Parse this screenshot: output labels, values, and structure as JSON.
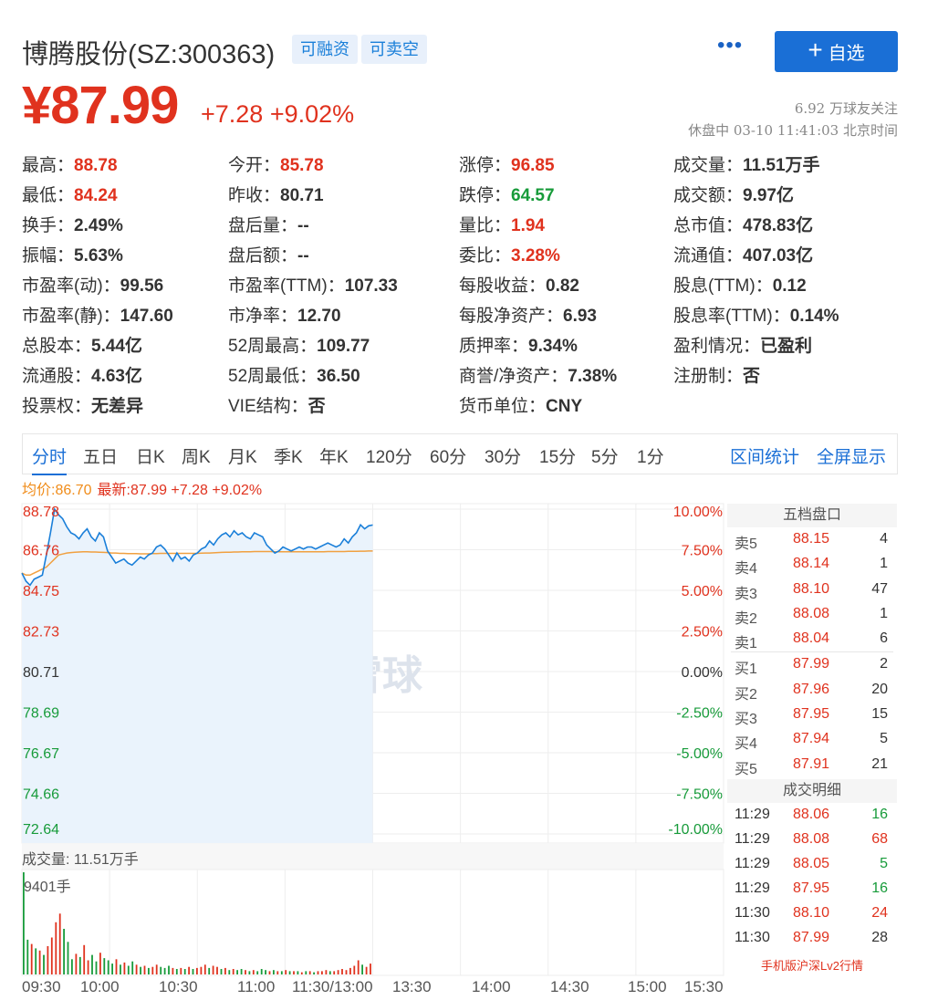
{
  "header": {
    "name": "博腾股份(SZ:300363)",
    "tags": [
      "可融资",
      "可卖空"
    ],
    "more": "•••",
    "follow_label": "自选",
    "price": "¥87.99",
    "change": "+7.28",
    "change_pct": "+9.02%",
    "followers": "6.92 万球友关注",
    "status": "休盘中 03-10 11:41:03 北京时间"
  },
  "quote": [
    [
      {
        "k": "最高：",
        "v": "88.78",
        "c": "red"
      },
      {
        "k": "今开：",
        "v": "85.78",
        "c": "red"
      },
      {
        "k": "涨停：",
        "v": "96.85",
        "c": "red"
      },
      {
        "k": "成交量：",
        "v": "11.51万手",
        "c": "dark"
      }
    ],
    [
      {
        "k": "最低：",
        "v": "84.24",
        "c": "red"
      },
      {
        "k": "昨收：",
        "v": "80.71",
        "c": "dark"
      },
      {
        "k": "跌停：",
        "v": "64.57",
        "c": "green"
      },
      {
        "k": "成交额：",
        "v": "9.97亿",
        "c": "dark"
      }
    ],
    [
      {
        "k": "换手：",
        "v": "2.49%",
        "c": "dark"
      },
      {
        "k": "盘后量：",
        "v": "--",
        "c": "dark"
      },
      {
        "k": "量比：",
        "v": "1.94",
        "c": "red"
      },
      {
        "k": "总市值：",
        "v": "478.83亿",
        "c": "dark"
      }
    ],
    [
      {
        "k": "振幅：",
        "v": "5.63%",
        "c": "dark"
      },
      {
        "k": "盘后额：",
        "v": "--",
        "c": "dark"
      },
      {
        "k": "委比：",
        "v": "3.28%",
        "c": "red"
      },
      {
        "k": "流通值：",
        "v": "407.03亿",
        "c": "dark"
      }
    ],
    [
      {
        "k": "市盈率(动)：",
        "v": "99.56",
        "c": "dark"
      },
      {
        "k": "市盈率(TTM)：",
        "v": "107.33",
        "c": "dark"
      },
      {
        "k": "每股收益：",
        "v": "0.82",
        "c": "dark"
      },
      {
        "k": "股息(TTM)：",
        "v": "0.12",
        "c": "dark"
      }
    ],
    [
      {
        "k": "市盈率(静)：",
        "v": "147.60",
        "c": "dark"
      },
      {
        "k": "市净率：",
        "v": "12.70",
        "c": "dark"
      },
      {
        "k": "每股净资产：",
        "v": "6.93",
        "c": "dark"
      },
      {
        "k": "股息率(TTM)：",
        "v": "0.14%",
        "c": "dark"
      }
    ],
    [
      {
        "k": "总股本：",
        "v": "5.44亿",
        "c": "dark"
      },
      {
        "k": "52周最高：",
        "v": "109.77",
        "c": "dark"
      },
      {
        "k": "质押率：",
        "v": "9.34%",
        "c": "dark"
      },
      {
        "k": "盈利情况：",
        "v": "已盈利",
        "c": "dark"
      }
    ],
    [
      {
        "k": "流通股：",
        "v": "4.63亿",
        "c": "dark"
      },
      {
        "k": "52周最低：",
        "v": "36.50",
        "c": "dark"
      },
      {
        "k": "商誉/净资产：",
        "v": "7.38%",
        "c": "dark"
      },
      {
        "k": "注册制：",
        "v": "否",
        "c": "dark"
      }
    ],
    [
      {
        "k": "投票权：",
        "v": "无差异",
        "c": "dark"
      },
      {
        "k": "VIE结构：",
        "v": "否",
        "c": "dark"
      },
      {
        "k": "货币单位：",
        "v": "CNY",
        "c": "dark"
      }
    ]
  ],
  "tabs": [
    "分时",
    "五日",
    "日K",
    "周K",
    "月K",
    "季K",
    "年K",
    "120分",
    "60分",
    "30分",
    "15分",
    "5分",
    "1分"
  ],
  "tab_right": [
    "区间统计",
    "全屏显示"
  ],
  "chart_header": {
    "avg": "均价:86.70",
    "latest": "最新:87.99 +7.28 +9.02%"
  },
  "chart_data": {
    "type": "line",
    "y_left_ticks": [
      "88.78",
      "86.76",
      "84.75",
      "82.73",
      "80.71",
      "78.69",
      "76.67",
      "74.66",
      "72.64"
    ],
    "y_right_ticks": [
      "10.00%",
      "7.50%",
      "5.00%",
      "2.50%",
      "0.00%",
      "-2.50%",
      "-5.00%",
      "-7.50%",
      "-10.00%"
    ],
    "ylim": [
      72.64,
      88.78
    ],
    "x_ticks": [
      "09:30",
      "10:00",
      "10:30",
      "11:00",
      "11:30/13:00",
      "13:30",
      "14:00",
      "14:30",
      "15:00",
      "15:30"
    ],
    "series": [
      {
        "values": [
          85.6,
          85.2,
          85.0,
          85.3,
          85.4,
          85.5,
          86.5,
          87.6,
          88.78,
          88.5,
          88.3,
          87.9,
          87.6,
          87.5,
          87.3,
          87.6,
          87.8,
          87.4,
          87.2,
          87.6,
          87.4,
          86.7,
          86.4,
          86.1,
          86.2,
          86.3,
          86.1,
          86.0,
          86.2,
          86.4,
          86.3,
          86.5,
          86.6,
          86.9,
          87.0,
          86.8,
          86.5,
          86.2,
          86.6,
          86.3,
          86.4,
          86.2,
          86.5,
          86.6,
          86.8,
          86.9,
          87.2,
          87.0,
          87.3,
          87.5,
          87.6,
          87.4,
          87.7,
          87.5,
          87.6,
          87.4,
          87.3,
          87.6,
          87.5,
          87.4,
          87.0,
          86.8,
          86.6,
          86.7,
          86.9,
          86.8,
          86.7,
          86.8,
          86.9,
          86.8,
          86.9,
          86.9,
          86.8,
          86.9,
          87.0,
          87.1,
          87.0,
          86.9,
          87.0,
          87.3,
          87.1,
          87.4,
          87.6,
          88.0,
          87.8,
          87.95,
          87.99
        ]
      },
      {
        "values": [
          85.6,
          85.5,
          85.5,
          85.6,
          85.7,
          85.8,
          85.9,
          86.1,
          86.3,
          86.5,
          86.55,
          86.6,
          86.62,
          86.64,
          86.65,
          86.66,
          86.66,
          86.65,
          86.65,
          86.64,
          86.63,
          86.62,
          86.6,
          86.6,
          86.58,
          86.58,
          86.57,
          86.57,
          86.57,
          86.56,
          86.56,
          86.56,
          86.57,
          86.57,
          86.58,
          86.58,
          86.58,
          86.58,
          86.58,
          86.58,
          86.58,
          86.58,
          86.58,
          86.58,
          86.59,
          86.6,
          86.6,
          86.61,
          86.62,
          86.63,
          86.64,
          86.64,
          86.65,
          86.65,
          86.66,
          86.66,
          86.66,
          86.67,
          86.67,
          86.67,
          86.67,
          86.67,
          86.66,
          86.66,
          86.66,
          86.66,
          86.66,
          86.66,
          86.66,
          86.66,
          86.66,
          86.66,
          86.66,
          86.66,
          86.66,
          86.67,
          86.67,
          86.67,
          86.67,
          86.67,
          86.68,
          86.68,
          86.68,
          86.69,
          86.69,
          86.7,
          86.7
        ]
      }
    ],
    "volume_label": "成交量: 11.51万手",
    "volume_max_label": "9401手",
    "volume": [
      {
        "v": 9401,
        "c": "green"
      },
      {
        "v": 3200,
        "c": "green"
      },
      {
        "v": 2800,
        "c": "red"
      },
      {
        "v": 2400,
        "c": "green"
      },
      {
        "v": 2200,
        "c": "red"
      },
      {
        "v": 1800,
        "c": "green"
      },
      {
        "v": 2600,
        "c": "red"
      },
      {
        "v": 3400,
        "c": "red"
      },
      {
        "v": 4800,
        "c": "red"
      },
      {
        "v": 5600,
        "c": "red"
      },
      {
        "v": 4200,
        "c": "green"
      },
      {
        "v": 3000,
        "c": "green"
      },
      {
        "v": 1400,
        "c": "green"
      },
      {
        "v": 1900,
        "c": "red"
      },
      {
        "v": 1600,
        "c": "green"
      },
      {
        "v": 2700,
        "c": "red"
      },
      {
        "v": 1300,
        "c": "red"
      },
      {
        "v": 1800,
        "c": "green"
      },
      {
        "v": 1200,
        "c": "green"
      },
      {
        "v": 2000,
        "c": "red"
      },
      {
        "v": 1500,
        "c": "green"
      },
      {
        "v": 1300,
        "c": "green"
      },
      {
        "v": 1000,
        "c": "green"
      },
      {
        "v": 1400,
        "c": "red"
      },
      {
        "v": 900,
        "c": "green"
      },
      {
        "v": 1100,
        "c": "red"
      },
      {
        "v": 800,
        "c": "green"
      },
      {
        "v": 1200,
        "c": "green"
      },
      {
        "v": 900,
        "c": "red"
      },
      {
        "v": 700,
        "c": "green"
      },
      {
        "v": 800,
        "c": "red"
      },
      {
        "v": 600,
        "c": "green"
      },
      {
        "v": 700,
        "c": "red"
      },
      {
        "v": 900,
        "c": "red"
      },
      {
        "v": 700,
        "c": "green"
      },
      {
        "v": 600,
        "c": "green"
      },
      {
        "v": 800,
        "c": "green"
      },
      {
        "v": 600,
        "c": "red"
      },
      {
        "v": 500,
        "c": "green"
      },
      {
        "v": 600,
        "c": "red"
      },
      {
        "v": 500,
        "c": "green"
      },
      {
        "v": 700,
        "c": "red"
      },
      {
        "v": 500,
        "c": "green"
      },
      {
        "v": 600,
        "c": "red"
      },
      {
        "v": 700,
        "c": "red"
      },
      {
        "v": 900,
        "c": "red"
      },
      {
        "v": 600,
        "c": "green"
      },
      {
        "v": 800,
        "c": "red"
      },
      {
        "v": 700,
        "c": "red"
      },
      {
        "v": 500,
        "c": "green"
      },
      {
        "v": 600,
        "c": "red"
      },
      {
        "v": 400,
        "c": "green"
      },
      {
        "v": 500,
        "c": "red"
      },
      {
        "v": 400,
        "c": "green"
      },
      {
        "v": 500,
        "c": "green"
      },
      {
        "v": 400,
        "c": "red"
      },
      {
        "v": 300,
        "c": "green"
      },
      {
        "v": 400,
        "c": "red"
      },
      {
        "v": 300,
        "c": "green"
      },
      {
        "v": 500,
        "c": "green"
      },
      {
        "v": 400,
        "c": "green"
      },
      {
        "v": 300,
        "c": "red"
      },
      {
        "v": 400,
        "c": "green"
      },
      {
        "v": 300,
        "c": "red"
      },
      {
        "v": 300,
        "c": "green"
      },
      {
        "v": 400,
        "c": "red"
      },
      {
        "v": 300,
        "c": "green"
      },
      {
        "v": 300,
        "c": "red"
      },
      {
        "v": 300,
        "c": "green"
      },
      {
        "v": 200,
        "c": "red"
      },
      {
        "v": 300,
        "c": "green"
      },
      {
        "v": 300,
        "c": "red"
      },
      {
        "v": 200,
        "c": "green"
      },
      {
        "v": 300,
        "c": "red"
      },
      {
        "v": 300,
        "c": "red"
      },
      {
        "v": 400,
        "c": "red"
      },
      {
        "v": 300,
        "c": "green"
      },
      {
        "v": 300,
        "c": "red"
      },
      {
        "v": 400,
        "c": "red"
      },
      {
        "v": 500,
        "c": "red"
      },
      {
        "v": 400,
        "c": "red"
      },
      {
        "v": 600,
        "c": "red"
      },
      {
        "v": 800,
        "c": "red"
      },
      {
        "v": 1300,
        "c": "red"
      },
      {
        "v": 900,
        "c": "green"
      },
      {
        "v": 700,
        "c": "red"
      },
      {
        "v": 1000,
        "c": "red"
      }
    ],
    "watermark": "雪球"
  },
  "book": {
    "title": "五档盘口",
    "asks": [
      {
        "lbl": "卖5",
        "p": "88.15",
        "v": "4"
      },
      {
        "lbl": "卖4",
        "p": "88.14",
        "v": "1"
      },
      {
        "lbl": "卖3",
        "p": "88.10",
        "v": "47"
      },
      {
        "lbl": "卖2",
        "p": "88.08",
        "v": "1"
      },
      {
        "lbl": "卖1",
        "p": "88.04",
        "v": "6"
      }
    ],
    "bids": [
      {
        "lbl": "买1",
        "p": "87.99",
        "v": "2"
      },
      {
        "lbl": "买2",
        "p": "87.96",
        "v": "20"
      },
      {
        "lbl": "买3",
        "p": "87.95",
        "v": "15"
      },
      {
        "lbl": "买4",
        "p": "87.94",
        "v": "5"
      },
      {
        "lbl": "买5",
        "p": "87.91",
        "v": "21"
      }
    ],
    "deals_title": "成交明细",
    "deals": [
      {
        "t": "11:29",
        "p": "88.06",
        "v": "16",
        "c": "green"
      },
      {
        "t": "11:29",
        "p": "88.08",
        "v": "68",
        "c": "red"
      },
      {
        "t": "11:29",
        "p": "88.05",
        "v": "5",
        "c": "green"
      },
      {
        "t": "11:29",
        "p": "87.95",
        "v": "16",
        "c": "green"
      },
      {
        "t": "11:30",
        "p": "88.10",
        "v": "24",
        "c": "red"
      },
      {
        "t": "11:30",
        "p": "87.99",
        "v": "28",
        "c": "dark"
      }
    ],
    "lv2": "手机版沪深Lv2行情"
  }
}
